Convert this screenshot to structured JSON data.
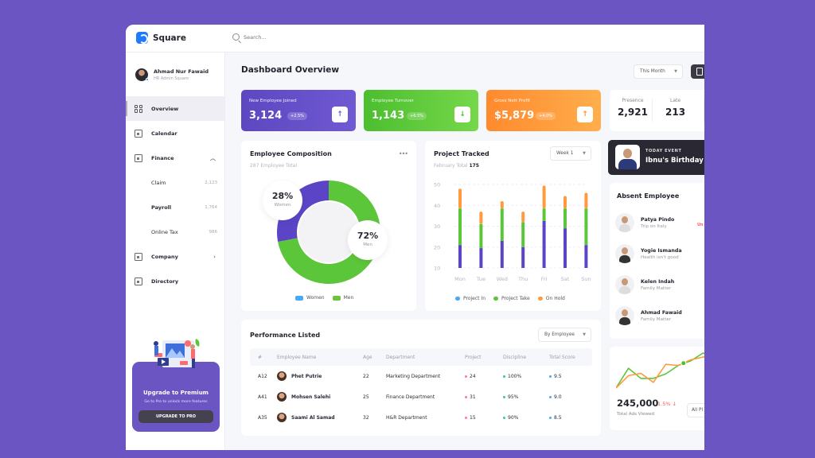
{
  "app": {
    "name": "Square",
    "search_placeholder": "Search..."
  },
  "profile": {
    "name": "Ahmad Nur Fawaid",
    "role": "HR Admin Square"
  },
  "sidebar": {
    "items": [
      {
        "label": "Overview",
        "icon": "grid-icon",
        "active": true
      },
      {
        "label": "Calendar",
        "icon": "calendar-icon"
      },
      {
        "label": "Finance",
        "icon": "finance-icon",
        "expanded": true
      },
      {
        "label": "Company",
        "icon": "briefcase-icon"
      },
      {
        "label": "Directory",
        "icon": "directory-icon"
      }
    ],
    "finance_sub": [
      {
        "label": "Claim",
        "count": "2,123"
      },
      {
        "label": "Payroll",
        "count": "1,764"
      },
      {
        "label": "Online Tax",
        "count": "986"
      }
    ],
    "upgrade": {
      "title": "Upgrade to Premium",
      "subtitle": "Go to Pro to unlock more features",
      "button": "UPGRADE TO PRO"
    }
  },
  "header": {
    "title": "Dashboard Overview",
    "period": "This Month"
  },
  "stats": [
    {
      "label": "New Employee Joined",
      "value": "3,124",
      "change": "+2.5%",
      "arrow": "↑",
      "color": "#5d48c2"
    },
    {
      "label": "Employee Turnover",
      "value": "1,143",
      "change": "+6.5%",
      "arrow": "↓",
      "color": "#4cbe2f"
    },
    {
      "label": "Gross Nett Profit",
      "value": "$5,879",
      "change": "+4.0%",
      "arrow": "↑",
      "color": "#ff8a2e"
    }
  ],
  "attendance": {
    "presence_label": "Presence",
    "presence_value": "2,921",
    "late_label": "Late",
    "late_value": "213"
  },
  "event": {
    "tag": "TODAY EVENT",
    "name": "Ibnu's Birthday"
  },
  "composition": {
    "title": "Employee Composition",
    "subtitle": "287 Employee Total",
    "more": "•••",
    "women_pct": "28%",
    "women_label": "Women",
    "men_pct": "72%",
    "men_label": "Men"
  },
  "project": {
    "title": "Project Tracked",
    "subtitle": "February Total",
    "total": "175",
    "filter": "Week 1"
  },
  "chart_data": [
    {
      "type": "pie",
      "title": "Employee Composition",
      "subtitle": "287 Employee Total",
      "categories": [
        "Women",
        "Men"
      ],
      "values": [
        28,
        72
      ],
      "colors": [
        "#5b45c6",
        "#5cc63a"
      ],
      "legend_colors": [
        "#48aaf7",
        "#6cc43a"
      ],
      "legend": "bottom"
    },
    {
      "type": "bar",
      "stacked": true,
      "title": "Project Tracked",
      "categories": [
        "Mon",
        "Tue",
        "Wed",
        "Thu",
        "Fri",
        "Sat",
        "Sun"
      ],
      "series": [
        {
          "name": "Project In",
          "color": "#5b45c6",
          "legend_color": "#48aaf7",
          "values": [
            21,
            19.5,
            23,
            20,
            32.5,
            29,
            21
          ]
        },
        {
          "name": "Project Take",
          "color": "#5cc63a",
          "values": [
            38.5,
            31,
            38.5,
            32,
            38.5,
            38.5,
            38.5
          ]
        },
        {
          "name": "On Hold",
          "color": "#ff9b3d",
          "values": [
            48,
            37,
            42,
            37,
            49.5,
            44.5,
            46
          ]
        }
      ],
      "value_note": "series values are cumulative top of each stack segment",
      "ylim": [
        10,
        50
      ],
      "yticks": [
        10,
        20,
        30,
        40,
        50
      ],
      "grid": true,
      "legend": "bottom"
    },
    {
      "type": "line",
      "title": "Total Ads Viewed",
      "series": [
        {
          "name": "green",
          "color": "#5cc63a",
          "values": [
            0,
            35,
            17,
            17,
            25,
            40,
            48,
            62,
            53
          ]
        },
        {
          "name": "orange",
          "color": "#ff9b3d",
          "values": [
            0,
            22,
            26,
            10,
            42,
            40,
            50,
            55,
            55
          ]
        }
      ]
    }
  ],
  "performance": {
    "title": "Performance Listed",
    "filter": "By Employee",
    "columns": [
      "#",
      "Employee Name",
      "Age",
      "Department",
      "Project",
      "Discipline",
      "Total Score"
    ],
    "rows": [
      {
        "id": "A12",
        "name": "Phet Putrie",
        "age": "22",
        "dept": "Marketing Department",
        "project": "24",
        "discipline": "100%",
        "score": "9.5"
      },
      {
        "id": "A41",
        "name": "Mohsen Salehi",
        "age": "25",
        "dept": "Finance Department",
        "project": "31",
        "discipline": "95%",
        "score": "9.0"
      },
      {
        "id": "A35",
        "name": "Saami Al Samad",
        "age": "32",
        "dept": "H&R Department",
        "project": "15",
        "discipline": "90%",
        "score": "8.5"
      }
    ],
    "dot_colors": {
      "project": "#ff7a9a",
      "discipline": "#3cc98a",
      "score": "#4aa8f5"
    }
  },
  "absent": {
    "title": "Absent Employee",
    "flag": "Un",
    "items": [
      {
        "name": "Patya Pindo",
        "reason": "Trip on Italy"
      },
      {
        "name": "Yogie Ismanda",
        "reason": "Health isn't good"
      },
      {
        "name": "Kelen Indah",
        "reason": "Family Matter"
      },
      {
        "name": "Ahmad Fawaid",
        "reason": "Family Matter"
      }
    ]
  },
  "ads": {
    "value": "245,000",
    "change": "1.5% ↓",
    "label": "Total Ads Viewed",
    "filter": "All Pl"
  }
}
